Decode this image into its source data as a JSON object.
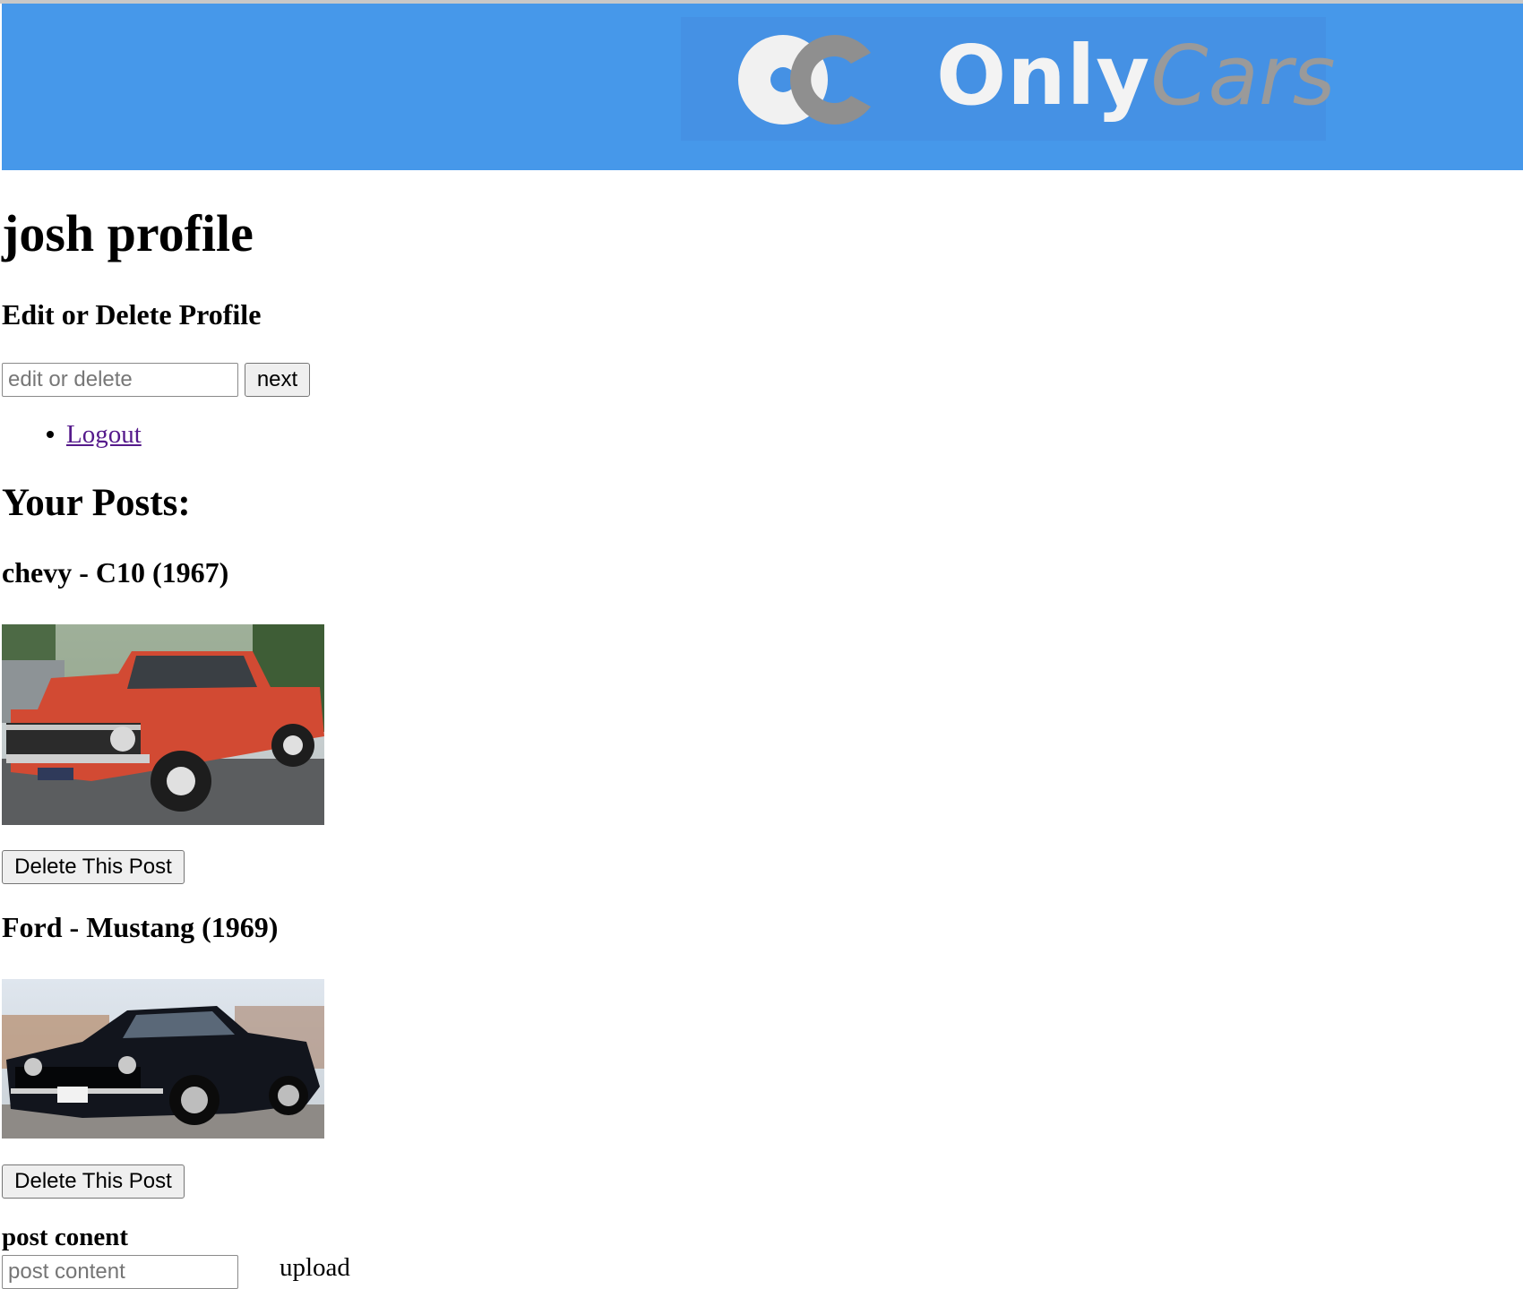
{
  "header": {
    "brand_primary": "Only",
    "brand_secondary": "Cars",
    "background_color": "#4698ea"
  },
  "profile": {
    "title": "josh profile",
    "edit_heading": "Edit or Delete Profile",
    "edit_input_placeholder": "edit or delete",
    "next_button": "next"
  },
  "nav": {
    "items": [
      {
        "label": "Logout"
      }
    ]
  },
  "posts": {
    "heading": "Your Posts:",
    "items": [
      {
        "title": "chevy - C10 (1967)",
        "image_icon": "red-pickup-truck-photo",
        "delete_label": "Delete This Post"
      },
      {
        "title": "Ford - Mustang (1969)",
        "image_icon": "black-muscle-car-photo",
        "delete_label": "Delete This Post"
      }
    ]
  },
  "new_post": {
    "content_label": "post conent",
    "content_placeholder": "post content",
    "upload_label": "upload"
  }
}
